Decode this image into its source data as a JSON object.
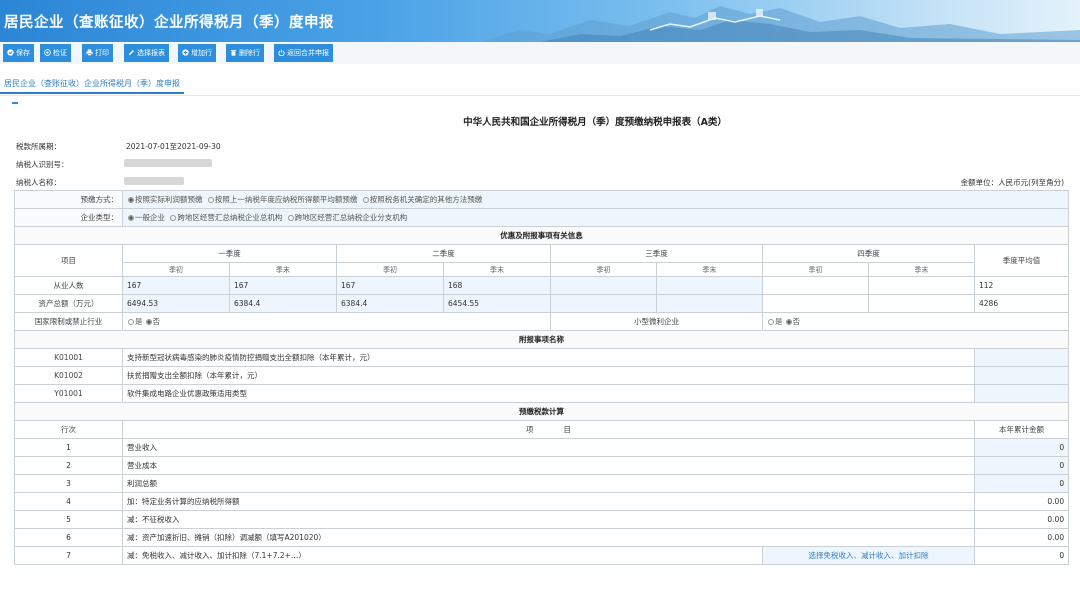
{
  "app_title": "居民企业（查账征收）企业所得税月（季）度申报",
  "toolbar": {
    "buttons": [
      {
        "label": "保存",
        "icon": "check-circle-icon"
      },
      {
        "label": "检证",
        "icon": "plus-circle-icon"
      },
      {
        "label": "打印",
        "icon": "printer-icon"
      },
      {
        "label": "选择报表",
        "icon": "pencil-icon"
      },
      {
        "label": "增加行",
        "icon": "add-circle-icon"
      },
      {
        "label": "删除行",
        "icon": "trash-icon"
      },
      {
        "label": "返回合并申报",
        "icon": "power-icon"
      }
    ]
  },
  "subtab": {
    "label": "居民企业（查账征收）企业所得税月（季）度申报"
  },
  "form": {
    "title": "中华人民共和国企业所得税月（季）度预缴纳税申报表（A类）",
    "period_label": "税款所属期：",
    "period_value": "2021-07-01至2021-09-30",
    "taxpayer_id_label": "纳税人识别号：",
    "taxpayer_name_label": "纳税人名称：",
    "unit": "金额单位：人民币元(列至角分)"
  },
  "prepay": {
    "label": "预缴方式：",
    "options": [
      "按照实际利润额预缴",
      "按照上一纳税年度应纳税所得额平均额预缴",
      "按照税务机关确定的其他方法预缴"
    ]
  },
  "enterprise_type": {
    "label": "企业类型：",
    "options": [
      "一般企业",
      "跨地区经营汇总纳税企业总机构",
      "跨地区经营汇总纳税企业分支机构"
    ]
  },
  "prefs": {
    "section_title": "优惠及附报事项有关信息",
    "item_header": "项目",
    "quarters": [
      "一季度",
      "二季度",
      "三季度",
      "四季度"
    ],
    "begin_label": "季初",
    "end_label": "季末",
    "avg_label": "季度平均值",
    "rows": [
      {
        "label": "从业人数",
        "values": [
          "167",
          "167",
          "167",
          "168",
          "",
          "",
          "",
          ""
        ],
        "avg": "112"
      },
      {
        "label": "资产总额（万元）",
        "values": [
          "6494.53",
          "6384.4",
          "6384.4",
          "6454.55",
          "",
          "",
          "",
          ""
        ],
        "avg": "4286"
      }
    ],
    "restricted_label": "国家限制或禁止行业",
    "small_label": "小型微利企业",
    "yes": "是",
    "no": "否"
  },
  "attach": {
    "section_title": "附报事项名称",
    "rows": [
      {
        "code": "K01001",
        "name": "支持新型冠状病毒感染的肺炎疫情防控捐赠支出全额扣除（本年累计，元）"
      },
      {
        "code": "K01002",
        "name": "扶贫捐赠支出全额扣除（本年累计，元）"
      },
      {
        "code": "Y01001",
        "name": "软件集成电路企业优惠政策适用类型"
      }
    ]
  },
  "calc": {
    "section_title": "预缴税款计算",
    "col_row": "行次",
    "col_item": "项　　　　目",
    "col_amount": "本年累计金额",
    "rows": [
      {
        "no": "1",
        "item": "营业收入",
        "amount": "0"
      },
      {
        "no": "2",
        "item": "营业成本",
        "amount": "0"
      },
      {
        "no": "3",
        "item": "利润总额",
        "amount": "0"
      },
      {
        "no": "4",
        "item": "加：特定业务计算的应纳税所得额",
        "amount": "0.00"
      },
      {
        "no": "5",
        "item": "减：不征税收入",
        "amount": "0.00"
      },
      {
        "no": "6",
        "item": "减：资产加速折旧、摊销（扣除）调减额（填写A201020）",
        "amount": "0.00"
      },
      {
        "no": "7",
        "item": "减：免税收入、减计收入、加计扣除（7.1+7.2+…）",
        "amount": "0",
        "link": "选择免税收入、减计收入、加计扣除"
      }
    ]
  }
}
